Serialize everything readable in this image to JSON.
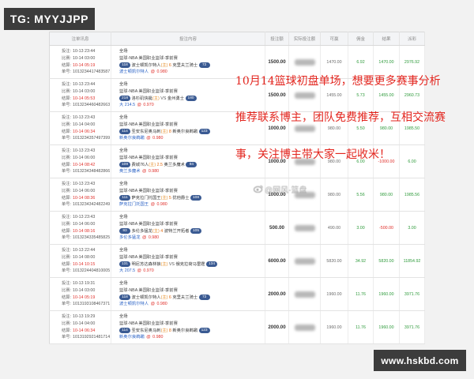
{
  "watermarks": {
    "top_left": "TG: MYYJJPP",
    "bottom_right": "www.hskbd.com",
    "weibo": "@网风-篮盘"
  },
  "overlay": {
    "lines": [
      "10月14篮球初盘单场，想要更多赛事分析",
      "推荐联系博主，团队免费推荐，互相交流赛",
      "事，关注博主带大家一起收米！"
    ]
  },
  "table": {
    "headers": {
      "info": "注单讯息",
      "content": "投注内容",
      "stake": "投注额",
      "actual_stake": "实际投注额",
      "to_win": "可赢",
      "commission": "佣金",
      "result": "结果",
      "payout": "派彩"
    },
    "labels": {
      "bet_time": "投注:",
      "match_time": "比赛:",
      "settle_time": "结算:",
      "ticket_no": "单号:",
      "home_mark": "(主)",
      "at": "@"
    },
    "rows": [
      {
        "bet_time": "10-13 23:44",
        "match_time": "10-14 03:00",
        "settle_time": "10-14 05:19",
        "ticket_no": "1013234417483587",
        "period": "全场",
        "league": "篮球-NBA 美国职业篮球-季前赛",
        "home_badge": "118",
        "home_team": "波士顿凯尔特人",
        "line": "6",
        "away_team": "克里夫兰骑士",
        "away_badge": "72",
        "pick": "波士顿凯尔特人",
        "odds": "0.980",
        "stake": "1500.00",
        "to_win": "1470.00",
        "commission": "6.92",
        "result": "1470.00",
        "payout": "2976.92"
      },
      {
        "bet_time": "10-13 23:44",
        "match_time": "10-14 03:00",
        "settle_time": "10-14 05:53",
        "ticket_no": "1013234460482663",
        "period": "全场",
        "league": "篮球-NBA 美国职业篮球-季前赛",
        "home_badge": "218",
        "home_team": "洛杉矶快艇",
        "line": "VS",
        "away_team": "金州勇士",
        "away_badge": "180",
        "pick": "大 214.5",
        "odds": "0.970",
        "stake": "1500.00",
        "to_win": "1455.00",
        "commission": "5.73",
        "result": "1455.00",
        "payout": "2960.73"
      },
      {
        "bet_time": "10-13 23:43",
        "match_time": "10-14 04:00",
        "settle_time": "10-14 06:34",
        "ticket_no": "1013234357497399",
        "period": "全场",
        "league": "篮球-NBA 美国职业篮球-季前赛",
        "home_badge": "114",
        "home_team": "圣安东尼奥马刺",
        "line": "8",
        "away_team": "新奥尔良鹈鹕",
        "away_badge": "123",
        "pick": "新奥尔良鹈鹕",
        "odds": "0.980",
        "stake": "1000.00",
        "to_win": "980.00",
        "commission": "5.50",
        "result": "980.00",
        "payout": "1985.50"
      },
      {
        "bet_time": "10-13 23:43",
        "match_time": "10-14 06:00",
        "settle_time": "10-14 08:42",
        "ticket_no": "1013234348482866",
        "period": "全场",
        "league": "篮球-NBA 美国职业篮球-季前赛",
        "home_badge": "109",
        "home_team": "费城76人",
        "line": "2.5",
        "away_team": "奥兰多魔术",
        "away_badge": "94",
        "pick": "奥兰多魔术",
        "odds": "0.980",
        "stake": "1000.00",
        "to_win": "980.00",
        "commission": "6.00",
        "result": "-1000.00",
        "payout": "6.00"
      },
      {
        "bet_time": "10-13 23:43",
        "match_time": "10-14 06:00",
        "settle_time": "10-14 08:36",
        "ticket_no": "1013234342482249",
        "period": "全场",
        "league": "篮球-NBA 美国职业篮球-季前赛",
        "home_badge": "111",
        "home_team": "萨克拉门托国王",
        "line": "5",
        "away_team": "犹他爵士",
        "away_badge": "108",
        "pick": "萨克拉门托国王",
        "odds": "0.980",
        "stake": "1000.00",
        "to_win": "980.00",
        "commission": "5.56",
        "result": "980.00",
        "payout": "1985.56"
      },
      {
        "bet_time": "10-13 23:43",
        "match_time": "10-14 06:00",
        "settle_time": "10-14 08:16",
        "ticket_no": "1013234335485825",
        "period": "全场",
        "league": "篮球-NBA 美国职业篮球-季前赛",
        "home_badge": "93",
        "home_team": "多伦多猛龙",
        "line": "4",
        "away_team": "波特兰开拓者",
        "away_badge": "105",
        "pick": "多伦多猛龙",
        "odds": "0.980",
        "stake": "500.00",
        "to_win": "490.00",
        "commission": "3.00",
        "result": "-500.00",
        "payout": "3.00"
      },
      {
        "bet_time": "10-13 22:44",
        "match_time": "10-14 08:00",
        "settle_time": "10-14 10:15",
        "ticket_no": "1013224404810005",
        "period": "全场",
        "league": "篮球-NBA 美国职业篮球-季前赛",
        "home_badge": "131",
        "home_team": "明尼苏达森林狼",
        "line": "VS",
        "away_team": "俄克拉荷马雷霆",
        "away_badge": "134",
        "pick": "大 207.5",
        "odds": "0.970",
        "stake": "6000.00",
        "to_win": "5820.00",
        "commission": "34.92",
        "result": "5820.00",
        "payout": "11854.92"
      },
      {
        "bet_time": "10-13 19:31",
        "match_time": "10-14 03:00",
        "settle_time": "10-14 05:19",
        "ticket_no": "1013193108467371",
        "period": "全场",
        "league": "篮球-NBA 美国职业篮球-季前赛",
        "home_badge": "118",
        "home_team": "波士顿凯尔特人",
        "line": "6",
        "away_team": "克里夫兰骑士",
        "away_badge": "72",
        "pick": "波士顿凯尔特人",
        "odds": "0.980",
        "stake": "2000.00",
        "to_win": "1960.00",
        "commission": "11.76",
        "result": "1960.00",
        "payout": "3971.76"
      },
      {
        "bet_time": "10-13 19:29",
        "match_time": "10-14 04:00",
        "settle_time": "10-14 06:34",
        "ticket_no": "1013192921481714",
        "period": "全场",
        "league": "篮球-NBA 美国职业篮球-季前赛",
        "home_badge": "114",
        "home_team": "圣安东尼奥马刺",
        "line": "8",
        "away_team": "新奥尔良鹈鹕",
        "away_badge": "123",
        "pick": "新奥尔良鹈鹕",
        "odds": "0.980",
        "stake": "2000.00",
        "to_win": "1960.00",
        "commission": "11.76",
        "result": "1960.00",
        "payout": "3971.76"
      }
    ]
  },
  "colors": {
    "positive": "#2f9b3c",
    "negative": "#e0302b",
    "overlay_text": "#e3261f",
    "badge": "#3a5a92",
    "watermark_box": "#3c3c3c"
  }
}
